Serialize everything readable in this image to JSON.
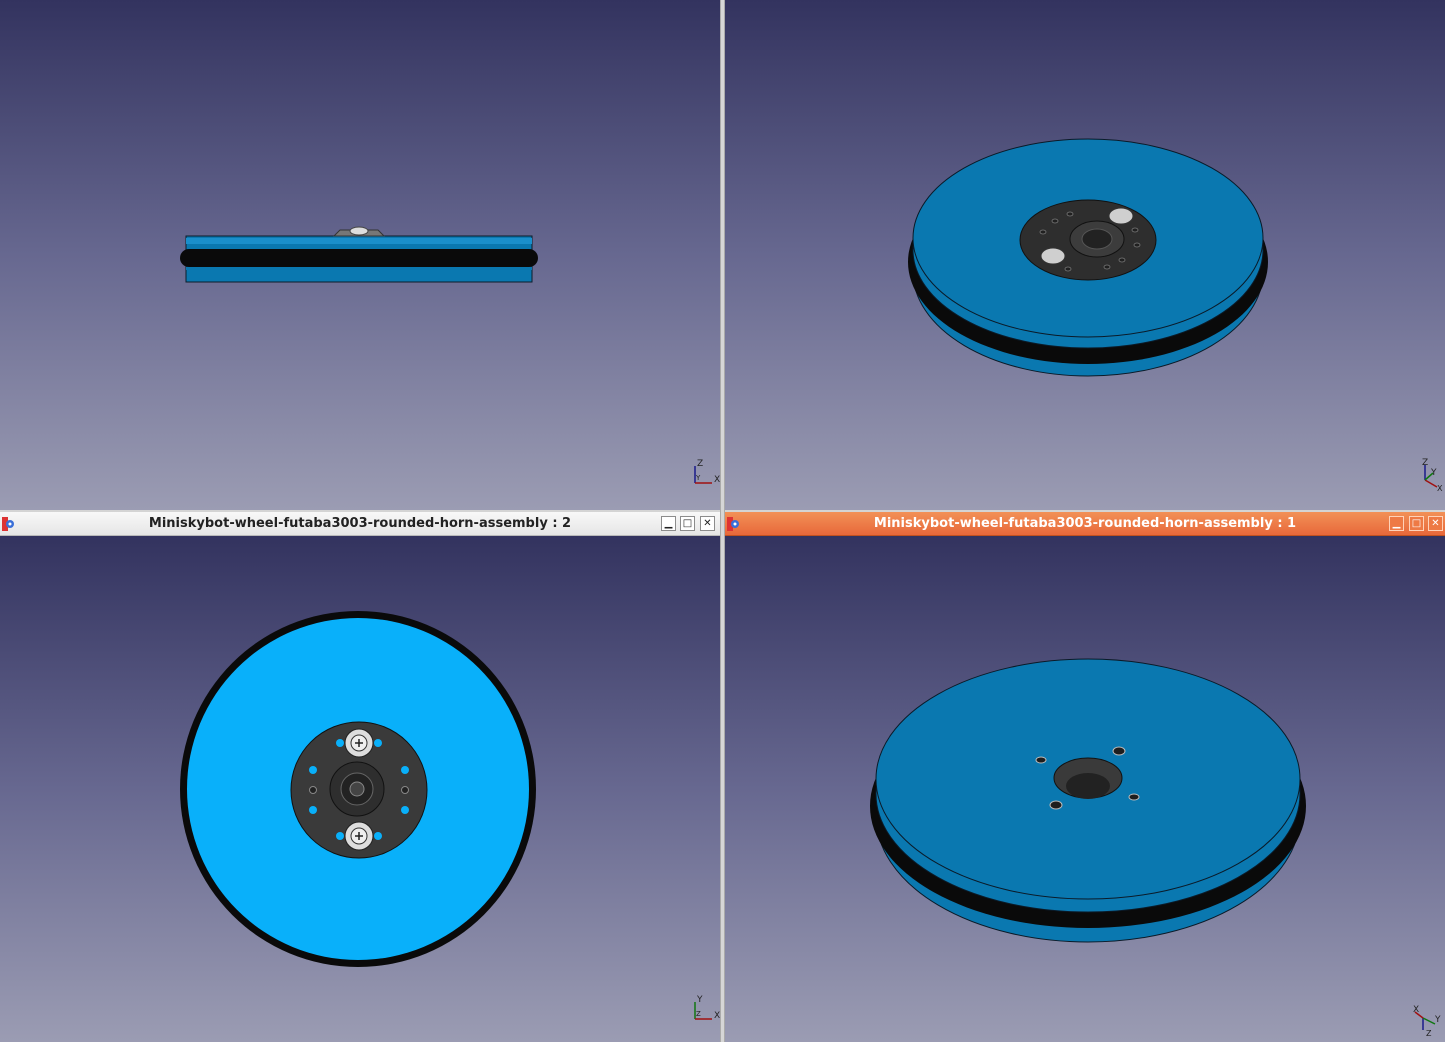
{
  "windows": [
    {
      "title": "Miniskybot-wheel-futaba3003-rounded-horn-assembly : 2",
      "active": false
    },
    {
      "title": "Miniskybot-wheel-futaba3003-rounded-horn-assembly : 1",
      "active": true
    }
  ],
  "window_buttons": {
    "minimize": "▁",
    "maximize": "□",
    "close": "✕"
  },
  "axes": {
    "top_left": {
      "up": "Z",
      "right": "X",
      "center": "Y"
    },
    "top_right": {
      "up": "Z",
      "right": "Y",
      "center": "X"
    },
    "bottom_left": {
      "up": "Y",
      "right": "X",
      "center": "Z"
    },
    "bottom_right": {
      "up": "X",
      "right": "Y",
      "center": "Z"
    }
  },
  "colors": {
    "wheel_blue": "#0a78b0",
    "wheel_face_blue": "#09b0fa",
    "tire_black": "#0a0a0a",
    "horn_dark": "#3a3a3a",
    "active_title": "#ee7642"
  }
}
